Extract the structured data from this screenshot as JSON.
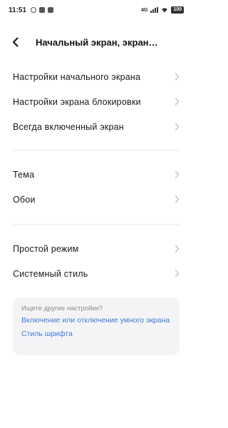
{
  "status_bar": {
    "time": "11:51",
    "battery": "100",
    "network_label": "4G"
  },
  "header": {
    "title": "Начальный экран, экран…"
  },
  "groups": [
    {
      "items": [
        {
          "label": "Настройки начального экрана"
        },
        {
          "label": "Настройки экрана блокировки"
        },
        {
          "label": "Всегда включенный экран"
        }
      ]
    },
    {
      "items": [
        {
          "label": "Тема"
        },
        {
          "label": "Обои"
        }
      ]
    },
    {
      "items": [
        {
          "label": "Простой режим"
        },
        {
          "label": "Системный стиль"
        }
      ]
    }
  ],
  "suggestions": {
    "hint": "Ищете другие настройки?",
    "links": [
      {
        "label": "Включение или отключение умного экрана"
      },
      {
        "label": "Стиль шрифта"
      }
    ]
  },
  "colors": {
    "link": "#3d7ad8",
    "card_background": "#f4f4f6",
    "chevron": "#c4c4c4"
  }
}
